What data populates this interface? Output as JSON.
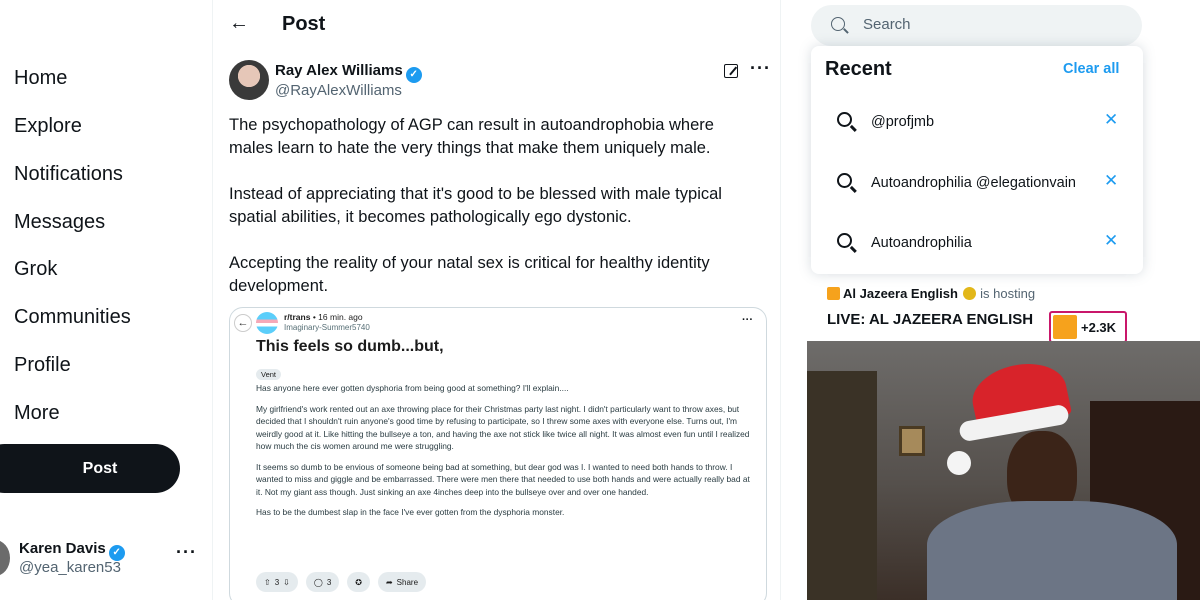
{
  "nav": {
    "items": [
      "Home",
      "Explore",
      "Notifications",
      "Messages",
      "Grok",
      "Communities",
      "Profile",
      "More"
    ],
    "post_button": "Post"
  },
  "account": {
    "name": "Karen Davis",
    "handle": "@yea_karen53"
  },
  "header": {
    "title": "Post"
  },
  "tweet": {
    "author_name": "Ray Alex Williams",
    "author_handle": "@RayAlexWilliams",
    "paragraphs": [
      "The psychopathology of AGP can result in autoandrophobia where males learn to hate the very things that make them uniquely male.",
      "Instead of appreciating that it's good to be blessed with male typical spatial abilities, it becomes pathologically ego dystonic.",
      "Accepting the reality of your natal sex is critical for healthy identity development."
    ]
  },
  "embed": {
    "subreddit": "r/trans",
    "time": "• 16 min. ago",
    "user": "Imaginary-Summer5740",
    "title": "This feels so dumb...but,",
    "flair": "Vent",
    "paragraphs": [
      "Has anyone here ever gotten dysphoria from being good at something? I'll explain....",
      "My girlfriend's work rented out an axe throwing place for their Christmas party last night. I didn't particularly want to throw axes, but decided that I shouldn't ruin anyone's good time by refusing to participate, so I threw some axes with everyone else. Turns out, I'm weirdly good at it. Like hitting the bullseye a ton, and having the axe not stick like twice all night. It was almost even fun until I realized how much the cis women around me were struggling.",
      "It seems so dumb to be envious of someone being bad at something, but dear god was I. I wanted to need both hands to throw. I wanted to miss and giggle and be embarrassed. There were men there that needed to use both hands and were actually really bad at it. Not my giant ass though. Just sinking an axe 4inches deep into the bullseye over and over one handed.",
      "Has to be the dumbest slap in the face I've ever gotten from the dysphoria monster."
    ],
    "votes": "3",
    "comments": "3",
    "share": "Share"
  },
  "search": {
    "placeholder": "Search",
    "recent_title": "Recent",
    "clear_all": "Clear all",
    "recent_items": [
      "@profjmb",
      "Autoandrophilia @elegationvain",
      "Autoandrophilia"
    ]
  },
  "live": {
    "host_name": "Al Jazeera English",
    "host_suffix": "is hosting",
    "title": "LIVE: AL JAZEERA ENGLISH",
    "listeners": "+2.3K"
  },
  "colors": {
    "accent": "#1d9bf0",
    "text": "#0f1419",
    "muted": "#536471"
  }
}
